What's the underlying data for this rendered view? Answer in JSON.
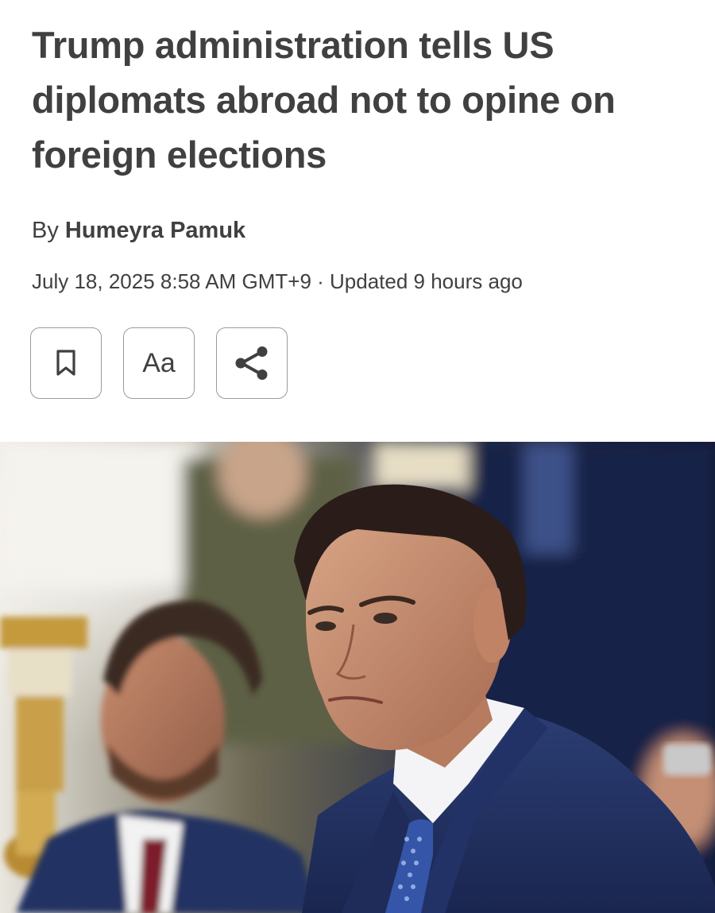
{
  "article": {
    "headline": "Trump administration tells US diplomats abroad not to opine on foreign elections",
    "byline_prefix": "By",
    "author": "Humeyra Pamuk",
    "dateline": "July 18, 2025 8:58 AM GMT+9 · Updated 9 hours ago"
  },
  "toolbar": {
    "bookmark_icon": "bookmark-icon",
    "text_size_label": "Aa",
    "share_icon": "share-icon"
  },
  "photo": {
    "subject": "photo"
  },
  "colors": {
    "text": "#404040",
    "border": "#9a9a9a",
    "suit_blue": "#22335f",
    "tie_red": "#8a1a2a"
  }
}
